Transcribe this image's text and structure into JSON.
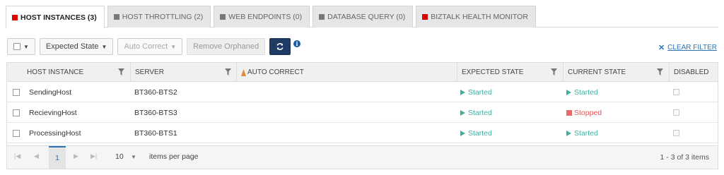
{
  "tabs": [
    {
      "label": "HOST INSTANCES (3)",
      "color": "#e00000",
      "active": true
    },
    {
      "label": "HOST THROTTLING (2)",
      "color": "#777777",
      "active": false
    },
    {
      "label": "WEB ENDPOINTS (0)",
      "color": "#777777",
      "active": false
    },
    {
      "label": "DATABASE QUERY (0)",
      "color": "#777777",
      "active": false
    },
    {
      "label": "BIZTALK HEALTH MONITOR",
      "color": "#e00000",
      "active": false
    }
  ],
  "toolbar": {
    "expected_state": "Expected State",
    "auto_correct": "Auto Correct",
    "remove_orphaned": "Remove Orphaned",
    "info_glyph": "i",
    "clear_filter": "CLEAR FILTER"
  },
  "grid": {
    "columns": {
      "host_instance": "HOST INSTANCE",
      "server": "SERVER",
      "auto_correct": "AUTO CORRECT",
      "expected_state": "EXPECTED STATE",
      "current_state": "CURRENT STATE",
      "disabled": "DISABLED"
    },
    "rows": [
      {
        "host": "SendingHost",
        "server": "BT360-BTS2",
        "expected": "Started",
        "current": "Started",
        "current_status": "started"
      },
      {
        "host": "RecievingHost",
        "server": "BT360-BTS3",
        "expected": "Started",
        "current": "Stopped",
        "current_status": "stopped"
      },
      {
        "host": "ProcessingHost",
        "server": "BT360-BTS1",
        "expected": "Started",
        "current": "Started",
        "current_status": "started"
      }
    ]
  },
  "pager": {
    "page": "1",
    "page_size": "10",
    "items_per_page": "items per page",
    "info": "1 - 3 of 3 items"
  },
  "colors": {
    "accent_blue": "#2a74b8",
    "refresh_button": "#1f3b63",
    "started": "#3fb0a0",
    "stopped": "#e05a5a"
  }
}
